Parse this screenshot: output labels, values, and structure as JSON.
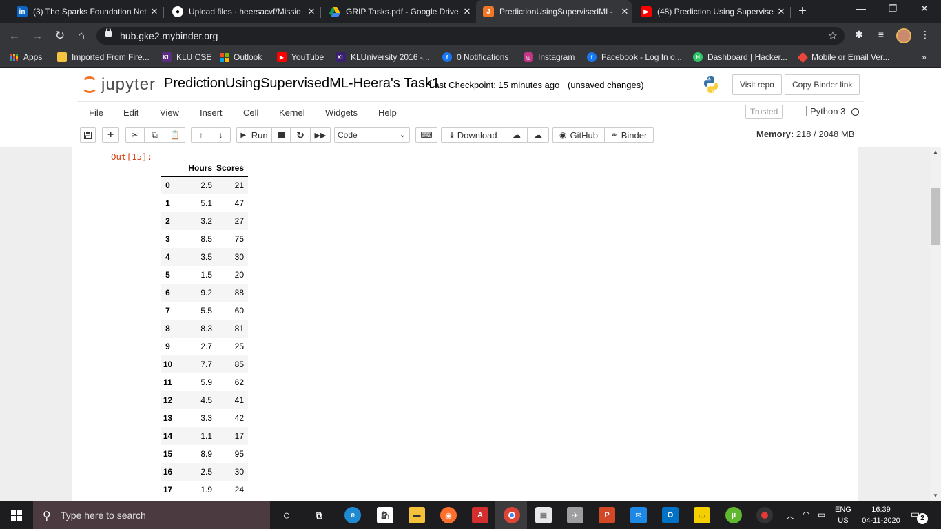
{
  "browser": {
    "tabs": [
      {
        "title": "(3) The Sparks Foundation Net",
        "icon": "linkedin-icon",
        "active": false
      },
      {
        "title": "Upload files · heersacvf/Missio",
        "icon": "github-icon",
        "active": false
      },
      {
        "title": "GRIP Tasks.pdf - Google Drive",
        "icon": "google-drive-icon",
        "active": false
      },
      {
        "title": "PredictionUsingSupervisedML-",
        "icon": "jupyter-icon",
        "active": true
      },
      {
        "title": "(48) Prediction Using Supervise",
        "icon": "youtube-icon",
        "active": false
      }
    ],
    "new_tab": "+",
    "url": "hub.gke2.mybinder.org",
    "bookmarks": [
      {
        "label": "Apps",
        "icon": "apps-grid-icon"
      },
      {
        "label": "Imported From Fire...",
        "icon": "folder-icon"
      },
      {
        "label": "KLU CSE",
        "icon": "klu-icon"
      },
      {
        "label": "Outlook",
        "icon": "microsoft-icon"
      },
      {
        "label": "YouTube",
        "icon": "youtube-icon"
      },
      {
        "label": "KLUniversity 2016 -...",
        "icon": "klu-icon"
      },
      {
        "label": "0 Notifications",
        "icon": "facebook-icon"
      },
      {
        "label": "Instagram",
        "icon": "instagram-icon"
      },
      {
        "label": "Facebook - Log In o...",
        "icon": "facebook-icon"
      },
      {
        "label": "Dashboard | Hacker...",
        "icon": "hackerrank-icon"
      },
      {
        "label": "Mobile or Email Ver...",
        "icon": "diamond-icon"
      }
    ],
    "more_bookmarks": "»"
  },
  "jupyter": {
    "logo_text": "jupyter",
    "notebook_name": "PredictionUsingSupervisedML-Heera's Task1",
    "checkpoint": "Last Checkpoint: 15 minutes ago",
    "unsaved": "(unsaved changes)",
    "visit_repo": "Visit repo",
    "copy_binder_link": "Copy Binder link",
    "menu": [
      "File",
      "Edit",
      "View",
      "Insert",
      "Cell",
      "Kernel",
      "Widgets",
      "Help"
    ],
    "trusted": "Trusted",
    "kernel_name": "Python 3",
    "toolbar": {
      "run": "Run",
      "cell_type": "Code",
      "download": "Download",
      "github": "GitHub",
      "binder": "Binder"
    },
    "memory_label": "Memory:",
    "memory_value": "218 / 2048 MB"
  },
  "output": {
    "prompt": "Out[15]:",
    "columns": [
      "",
      "Hours",
      "Scores"
    ],
    "rows": [
      [
        "0",
        "2.5",
        "21"
      ],
      [
        "1",
        "5.1",
        "47"
      ],
      [
        "2",
        "3.2",
        "27"
      ],
      [
        "3",
        "8.5",
        "75"
      ],
      [
        "4",
        "3.5",
        "30"
      ],
      [
        "5",
        "1.5",
        "20"
      ],
      [
        "6",
        "9.2",
        "88"
      ],
      [
        "7",
        "5.5",
        "60"
      ],
      [
        "8",
        "8.3",
        "81"
      ],
      [
        "9",
        "2.7",
        "25"
      ],
      [
        "10",
        "7.7",
        "85"
      ],
      [
        "11",
        "5.9",
        "62"
      ],
      [
        "12",
        "4.5",
        "41"
      ],
      [
        "13",
        "3.3",
        "42"
      ],
      [
        "14",
        "1.1",
        "17"
      ],
      [
        "15",
        "8.9",
        "95"
      ],
      [
        "16",
        "2.5",
        "30"
      ],
      [
        "17",
        "1.9",
        "24"
      ]
    ]
  },
  "taskbar": {
    "search_placeholder": "Type here to search",
    "lang_top": "ENG",
    "lang_bottom": "US",
    "time": "16:39",
    "date": "04-11-2020",
    "notification_count": "2"
  },
  "colors": {
    "jupyter_orange": "#f37626",
    "prompt_red": "#d84315",
    "chrome_dark": "#202124",
    "chrome_toolbar": "#35363a"
  }
}
